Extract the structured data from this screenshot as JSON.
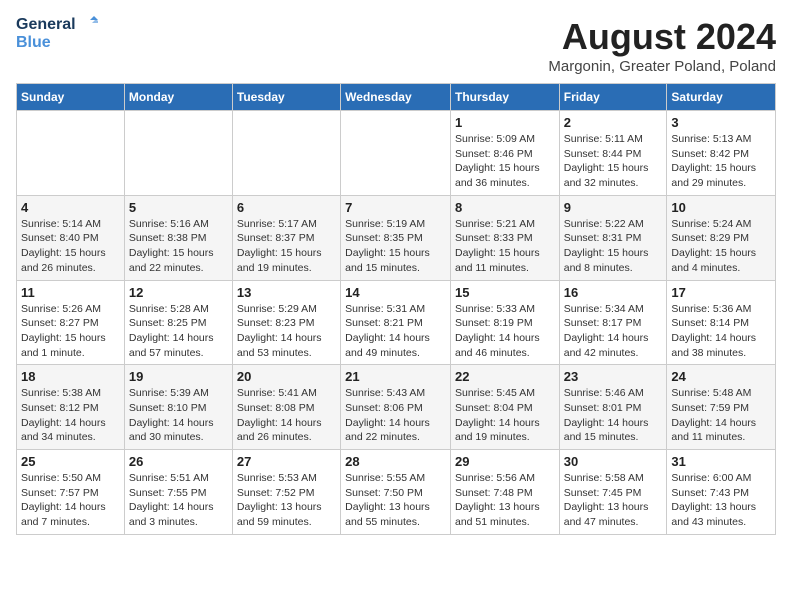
{
  "header": {
    "logo_line1": "General",
    "logo_line2": "Blue",
    "month_title": "August 2024",
    "location": "Margonin, Greater Poland, Poland"
  },
  "weekdays": [
    "Sunday",
    "Monday",
    "Tuesday",
    "Wednesday",
    "Thursday",
    "Friday",
    "Saturday"
  ],
  "weeks": [
    [
      {
        "day": "",
        "info": ""
      },
      {
        "day": "",
        "info": ""
      },
      {
        "day": "",
        "info": ""
      },
      {
        "day": "",
        "info": ""
      },
      {
        "day": "1",
        "info": "Sunrise: 5:09 AM\nSunset: 8:46 PM\nDaylight: 15 hours\nand 36 minutes."
      },
      {
        "day": "2",
        "info": "Sunrise: 5:11 AM\nSunset: 8:44 PM\nDaylight: 15 hours\nand 32 minutes."
      },
      {
        "day": "3",
        "info": "Sunrise: 5:13 AM\nSunset: 8:42 PM\nDaylight: 15 hours\nand 29 minutes."
      }
    ],
    [
      {
        "day": "4",
        "info": "Sunrise: 5:14 AM\nSunset: 8:40 PM\nDaylight: 15 hours\nand 26 minutes."
      },
      {
        "day": "5",
        "info": "Sunrise: 5:16 AM\nSunset: 8:38 PM\nDaylight: 15 hours\nand 22 minutes."
      },
      {
        "day": "6",
        "info": "Sunrise: 5:17 AM\nSunset: 8:37 PM\nDaylight: 15 hours\nand 19 minutes."
      },
      {
        "day": "7",
        "info": "Sunrise: 5:19 AM\nSunset: 8:35 PM\nDaylight: 15 hours\nand 15 minutes."
      },
      {
        "day": "8",
        "info": "Sunrise: 5:21 AM\nSunset: 8:33 PM\nDaylight: 15 hours\nand 11 minutes."
      },
      {
        "day": "9",
        "info": "Sunrise: 5:22 AM\nSunset: 8:31 PM\nDaylight: 15 hours\nand 8 minutes."
      },
      {
        "day": "10",
        "info": "Sunrise: 5:24 AM\nSunset: 8:29 PM\nDaylight: 15 hours\nand 4 minutes."
      }
    ],
    [
      {
        "day": "11",
        "info": "Sunrise: 5:26 AM\nSunset: 8:27 PM\nDaylight: 15 hours\nand 1 minute."
      },
      {
        "day": "12",
        "info": "Sunrise: 5:28 AM\nSunset: 8:25 PM\nDaylight: 14 hours\nand 57 minutes."
      },
      {
        "day": "13",
        "info": "Sunrise: 5:29 AM\nSunset: 8:23 PM\nDaylight: 14 hours\nand 53 minutes."
      },
      {
        "day": "14",
        "info": "Sunrise: 5:31 AM\nSunset: 8:21 PM\nDaylight: 14 hours\nand 49 minutes."
      },
      {
        "day": "15",
        "info": "Sunrise: 5:33 AM\nSunset: 8:19 PM\nDaylight: 14 hours\nand 46 minutes."
      },
      {
        "day": "16",
        "info": "Sunrise: 5:34 AM\nSunset: 8:17 PM\nDaylight: 14 hours\nand 42 minutes."
      },
      {
        "day": "17",
        "info": "Sunrise: 5:36 AM\nSunset: 8:14 PM\nDaylight: 14 hours\nand 38 minutes."
      }
    ],
    [
      {
        "day": "18",
        "info": "Sunrise: 5:38 AM\nSunset: 8:12 PM\nDaylight: 14 hours\nand 34 minutes."
      },
      {
        "day": "19",
        "info": "Sunrise: 5:39 AM\nSunset: 8:10 PM\nDaylight: 14 hours\nand 30 minutes."
      },
      {
        "day": "20",
        "info": "Sunrise: 5:41 AM\nSunset: 8:08 PM\nDaylight: 14 hours\nand 26 minutes."
      },
      {
        "day": "21",
        "info": "Sunrise: 5:43 AM\nSunset: 8:06 PM\nDaylight: 14 hours\nand 22 minutes."
      },
      {
        "day": "22",
        "info": "Sunrise: 5:45 AM\nSunset: 8:04 PM\nDaylight: 14 hours\nand 19 minutes."
      },
      {
        "day": "23",
        "info": "Sunrise: 5:46 AM\nSunset: 8:01 PM\nDaylight: 14 hours\nand 15 minutes."
      },
      {
        "day": "24",
        "info": "Sunrise: 5:48 AM\nSunset: 7:59 PM\nDaylight: 14 hours\nand 11 minutes."
      }
    ],
    [
      {
        "day": "25",
        "info": "Sunrise: 5:50 AM\nSunset: 7:57 PM\nDaylight: 14 hours\nand 7 minutes."
      },
      {
        "day": "26",
        "info": "Sunrise: 5:51 AM\nSunset: 7:55 PM\nDaylight: 14 hours\nand 3 minutes."
      },
      {
        "day": "27",
        "info": "Sunrise: 5:53 AM\nSunset: 7:52 PM\nDaylight: 13 hours\nand 59 minutes."
      },
      {
        "day": "28",
        "info": "Sunrise: 5:55 AM\nSunset: 7:50 PM\nDaylight: 13 hours\nand 55 minutes."
      },
      {
        "day": "29",
        "info": "Sunrise: 5:56 AM\nSunset: 7:48 PM\nDaylight: 13 hours\nand 51 minutes."
      },
      {
        "day": "30",
        "info": "Sunrise: 5:58 AM\nSunset: 7:45 PM\nDaylight: 13 hours\nand 47 minutes."
      },
      {
        "day": "31",
        "info": "Sunrise: 6:00 AM\nSunset: 7:43 PM\nDaylight: 13 hours\nand 43 minutes."
      }
    ]
  ]
}
